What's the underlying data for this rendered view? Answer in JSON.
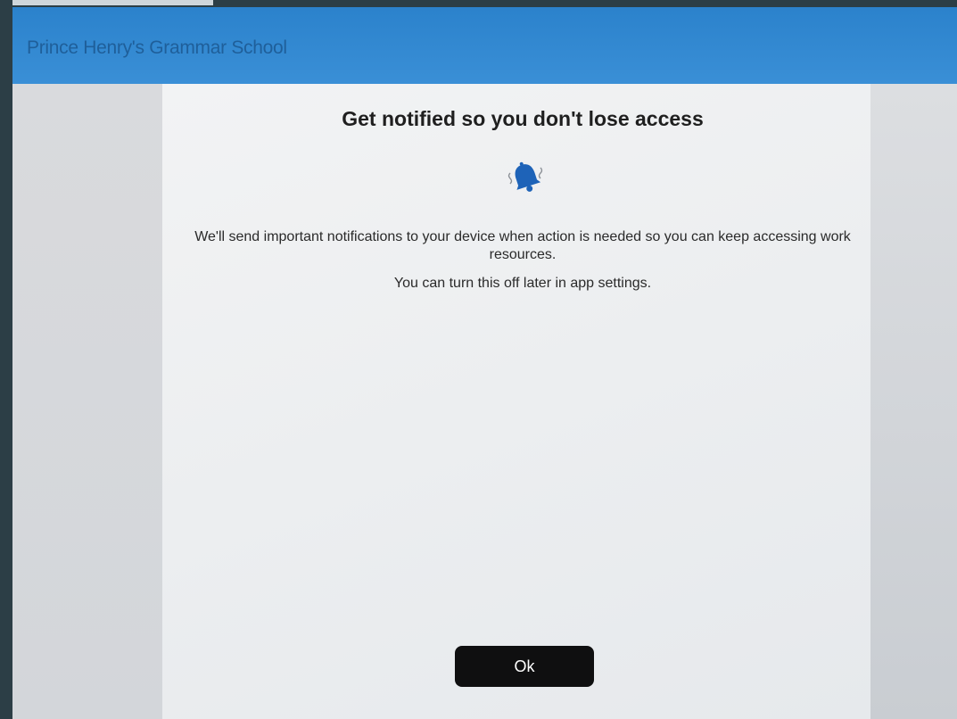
{
  "header": {
    "school_name": "Prince Henry's Grammar School"
  },
  "dialog": {
    "title": "Get notified so you don't lose access",
    "icon": "bell-icon",
    "body": "We'll send important notifications to your device when action is needed so you can keep accessing work resources.",
    "sub": "You can turn this off later in app settings.",
    "ok_label": "Ok"
  },
  "colors": {
    "header_blue": "#2b82cc",
    "bell_blue": "#1e63b8",
    "button_dark": "#0f0f10"
  }
}
